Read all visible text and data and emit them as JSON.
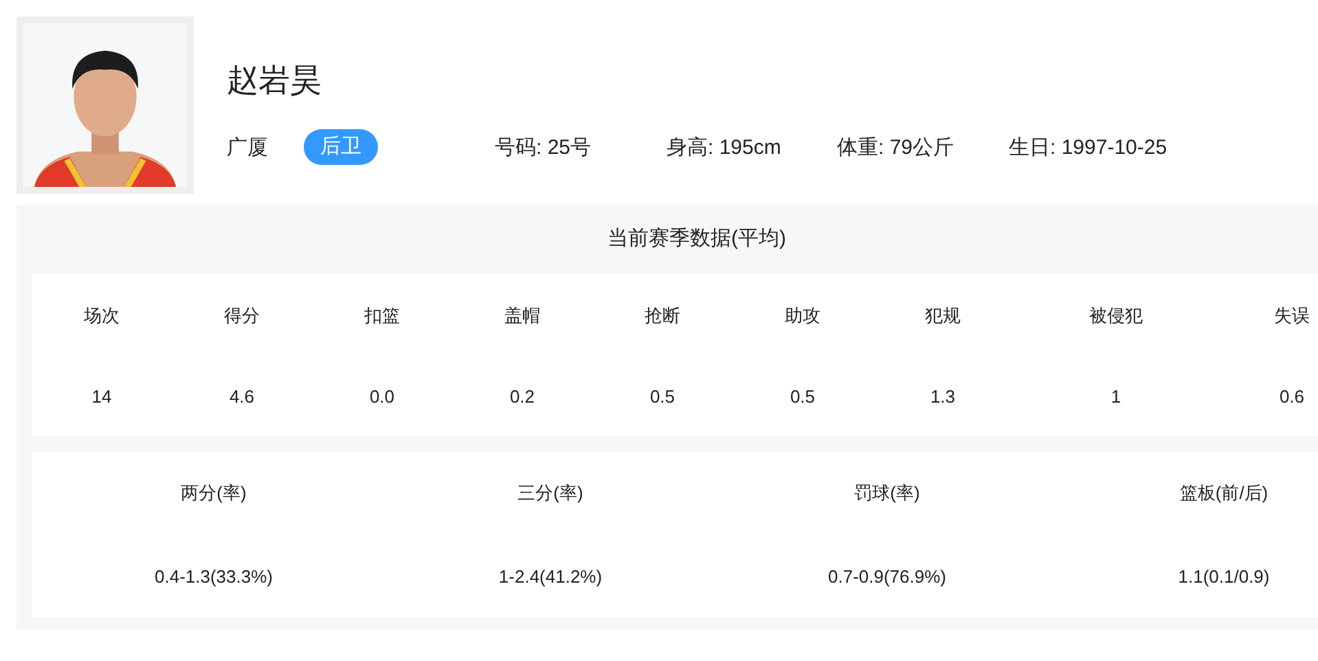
{
  "player": {
    "name": "赵岩昊",
    "team": "广厦",
    "position": "后卫",
    "details": [
      "号码: 25号",
      "身高: 195cm",
      "体重: 79公斤",
      "生日: 1997-10-25"
    ]
  },
  "season_stats": {
    "title": "当前赛季数据(平均)",
    "basic": [
      {
        "label": "场次",
        "value": "14"
      },
      {
        "label": "得分",
        "value": "4.6"
      },
      {
        "label": "扣篮",
        "value": "0.0"
      },
      {
        "label": "盖帽",
        "value": "0.2"
      },
      {
        "label": "抢断",
        "value": "0.5"
      },
      {
        "label": "助攻",
        "value": "0.5"
      },
      {
        "label": "犯规",
        "value": "1.3"
      },
      {
        "label": "被侵犯",
        "value": "1"
      },
      {
        "label": "失误",
        "value": "0.6"
      }
    ],
    "shooting": [
      {
        "label": "两分(率)",
        "value": "0.4-1.3(33.3%)"
      },
      {
        "label": "三分(率)",
        "value": "1-2.4(41.2%)"
      },
      {
        "label": "罚球(率)",
        "value": "0.7-0.9(76.9%)"
      },
      {
        "label": "篮板(前/后)",
        "value": "1.1(0.1/0.9)"
      }
    ]
  }
}
